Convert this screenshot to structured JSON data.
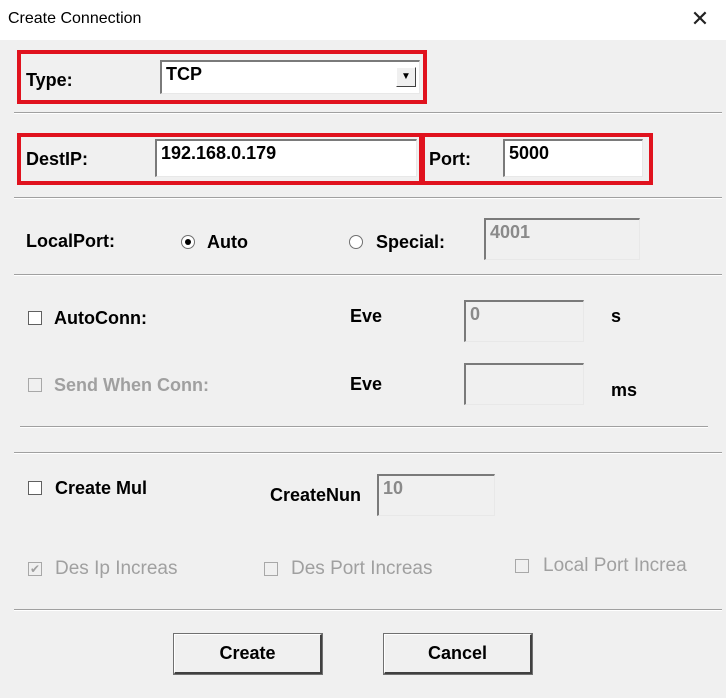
{
  "window": {
    "title": "Create Connection"
  },
  "type": {
    "label": "Type:",
    "value": "TCP"
  },
  "dest": {
    "ip_label": "DestIP:",
    "ip_value": "192.168.0.179",
    "port_label": "Port:",
    "port_value": "5000"
  },
  "local_port": {
    "label": "LocalPort:",
    "auto_label": "Auto",
    "special_label": "Special:",
    "special_value": "4001",
    "selected": "Auto"
  },
  "auto_conn": {
    "label": "AutoConn:",
    "checked": false,
    "every_label": "Eve",
    "every_value": "0",
    "unit": "s"
  },
  "send_when_conn": {
    "label": "Send When Conn:",
    "checked": false,
    "every_label": "Eve",
    "every_value": "",
    "unit": "ms"
  },
  "create_mul": {
    "label": "Create Mul",
    "checked": false,
    "num_label": "CreateNun",
    "num_value": "10"
  },
  "increase": {
    "des_ip_label": "Des Ip Increas",
    "des_ip_checked": true,
    "des_port_label": "Des Port Increas",
    "des_port_checked": false,
    "local_port_label": "Local Port Increa",
    "local_port_checked": false
  },
  "buttons": {
    "create": "Create",
    "cancel": "Cancel"
  },
  "colors": {
    "highlight": "#e0121e",
    "disabled_text": "#a0a0a0"
  },
  "icons": {
    "close": "close-icon",
    "dropdown": "chevron-down-icon",
    "checkmark": "check-icon"
  }
}
